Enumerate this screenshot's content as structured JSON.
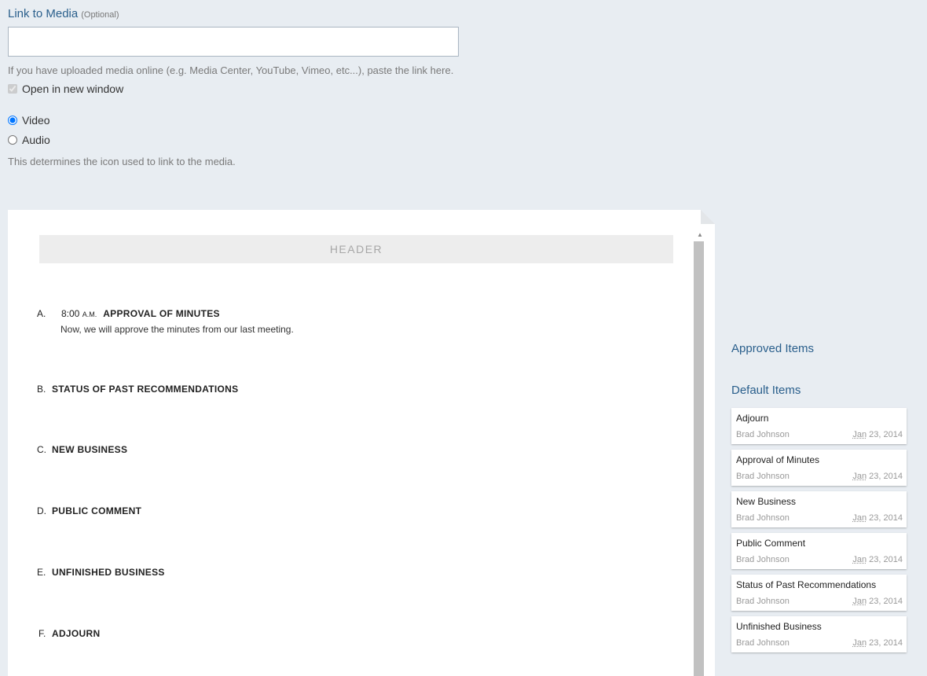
{
  "media": {
    "label": "Link to Media",
    "optional": "(Optional)",
    "input_value": "",
    "help": "If you have uploaded media online (e.g. Media Center, YouTube, Vimeo, etc...), paste the link here.",
    "open_new_window": "Open in new window",
    "video": "Video",
    "audio": "Audio",
    "type_help": "This determines the icon used to link to the media."
  },
  "agenda": {
    "header": "HEADER",
    "items": [
      {
        "letter": "A.",
        "time": "8:00",
        "ampm": "A.M.",
        "title": "APPROVAL OF MINUTES",
        "desc": "Now, we will approve the minutes from our last meeting."
      },
      {
        "letter": "B.",
        "title": "STATUS OF PAST RECOMMENDATIONS"
      },
      {
        "letter": "C.",
        "title": "NEW BUSINESS"
      },
      {
        "letter": "D.",
        "title": "PUBLIC COMMENT"
      },
      {
        "letter": "E.",
        "title": "UNFINISHED BUSINESS"
      },
      {
        "letter": "F.",
        "title": "ADJOURN"
      }
    ]
  },
  "sidebar": {
    "approved_heading": "Approved Items",
    "default_heading": "Default Items",
    "cards": [
      {
        "title": "Adjourn",
        "author": "Brad Johnson",
        "month": "Jan",
        "date": " 23, 2014"
      },
      {
        "title": "Approval of Minutes",
        "author": "Brad Johnson",
        "month": "Jan",
        "date": " 23, 2014"
      },
      {
        "title": "New Business",
        "author": "Brad Johnson",
        "month": "Jan",
        "date": " 23, 2014"
      },
      {
        "title": "Public Comment",
        "author": "Brad Johnson",
        "month": "Jan",
        "date": " 23, 2014"
      },
      {
        "title": "Status of Past Recommendations",
        "author": "Brad Johnson",
        "month": "Jan",
        "date": " 23, 2014"
      },
      {
        "title": "Unfinished Business",
        "author": "Brad Johnson",
        "month": "Jan",
        "date": " 23, 2014"
      }
    ]
  }
}
